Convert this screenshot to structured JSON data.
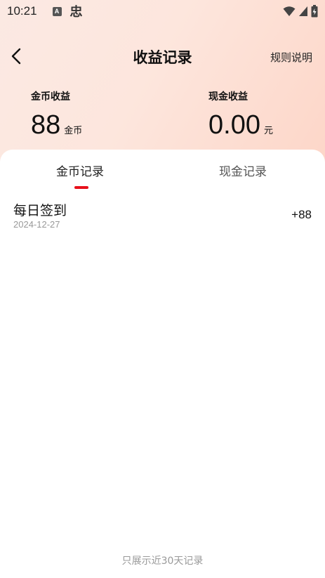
{
  "status_bar": {
    "time": "10:21",
    "notif_icon_letter": "A",
    "app_icon_glyph": "忠"
  },
  "header": {
    "title": "收益记录",
    "rules_label": "规则说明"
  },
  "summary": {
    "coins": {
      "label": "金币收益",
      "value": "88",
      "unit": "金币"
    },
    "cash": {
      "label": "现金收益",
      "value": "0.00",
      "unit": "元"
    }
  },
  "tabs": [
    {
      "label": "金币记录",
      "active": true
    },
    {
      "label": "现金记录",
      "active": false
    }
  ],
  "records": [
    {
      "title": "每日签到",
      "date": "2024-12-27",
      "amount": "+88"
    }
  ],
  "footer_note": "只展示近30天记录",
  "colors": {
    "accent": "#e8101b",
    "header_gradient_start": "#fbe9e3",
    "header_gradient_end": "#fdd6c8"
  },
  "icons": {
    "back": "chevron-left-icon",
    "wifi": "wifi-icon",
    "signal": "signal-icon",
    "battery": "battery-icon"
  }
}
